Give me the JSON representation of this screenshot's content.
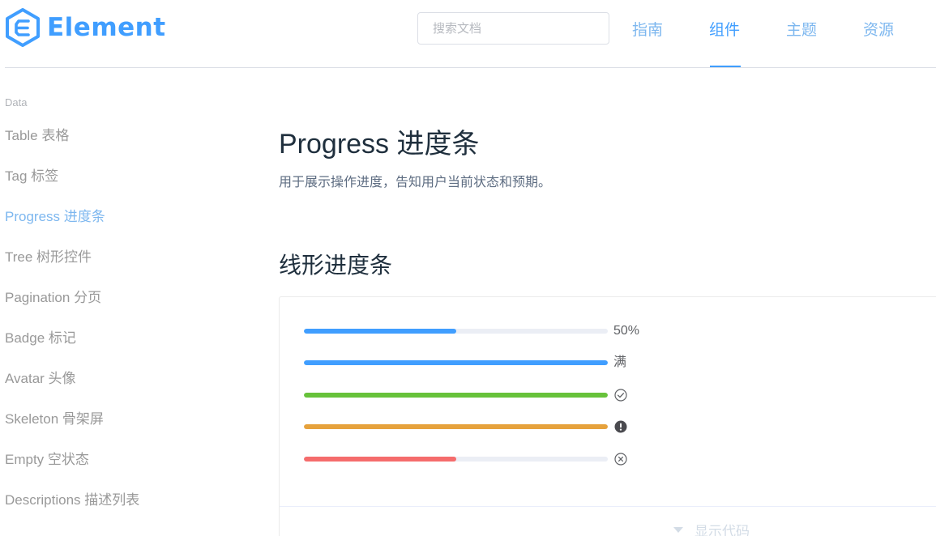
{
  "header": {
    "brand": "Element",
    "search_placeholder": "搜索文档",
    "nav": [
      {
        "label": "指南",
        "active": false
      },
      {
        "label": "组件",
        "active": true
      },
      {
        "label": "主题",
        "active": false
      },
      {
        "label": "资源",
        "active": false
      }
    ]
  },
  "sidebar": {
    "group": "Data",
    "items": [
      {
        "label": "Table 表格",
        "active": false
      },
      {
        "label": "Tag 标签",
        "active": false
      },
      {
        "label": "Progress 进度条",
        "active": true
      },
      {
        "label": "Tree 树形控件",
        "active": false
      },
      {
        "label": "Pagination 分页",
        "active": false
      },
      {
        "label": "Badge 标记",
        "active": false
      },
      {
        "label": "Avatar 头像",
        "active": false
      },
      {
        "label": "Skeleton 骨架屏",
        "active": false
      },
      {
        "label": "Empty 空状态",
        "active": false
      },
      {
        "label": "Descriptions 描述列表",
        "active": false
      }
    ]
  },
  "main": {
    "title": "Progress 进度条",
    "description": "用于展示操作进度，告知用户当前状态和预期。",
    "section_title": "线形进度条",
    "progress_bars": [
      {
        "percent": 50,
        "status": "default",
        "color": "#409eff",
        "text": "50%",
        "icon": ""
      },
      {
        "percent": 100,
        "status": "format",
        "color": "#409eff",
        "text": "满",
        "icon": ""
      },
      {
        "percent": 100,
        "status": "success",
        "color": "#67c23a",
        "text": "",
        "icon": "circle-check-icon"
      },
      {
        "percent": 100,
        "status": "warning",
        "color": "#e6a23c",
        "text": "",
        "icon": "warning-filled-icon"
      },
      {
        "percent": 50,
        "status": "exception",
        "color": "#f56c6c",
        "text": "",
        "icon": "circle-close-icon"
      }
    ],
    "show_code_label": "显示代码"
  }
}
